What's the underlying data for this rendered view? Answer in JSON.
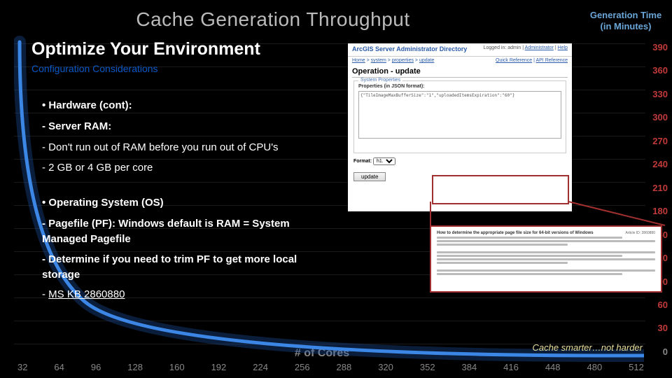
{
  "chart_data": {
    "type": "line",
    "title": "Cache Generation Throughput",
    "y_title": "Generation Time (in Minutes)",
    "xlabel": "# of Cores",
    "x": [
      32,
      64,
      96,
      128,
      160,
      192,
      224,
      256,
      288,
      320,
      352,
      384,
      416,
      448,
      480,
      512
    ],
    "y": [
      390,
      190,
      125,
      95,
      76,
      64,
      55,
      49,
      44,
      40,
      36,
      33,
      31,
      29,
      27,
      25
    ],
    "ylim": [
      0,
      390
    ],
    "y_ticks": [
      390,
      360,
      330,
      300,
      270,
      240,
      210,
      180,
      150,
      120,
      90,
      60,
      30,
      0
    ]
  },
  "slide": {
    "heading": "Optimize Your Environment",
    "subheading": "Configuration Considerations",
    "section1": {
      "title": "Hardware (cont):",
      "sub1": "Server RAM:",
      "b1": "Don't run out of RAM before you run out of CPU's",
      "b2": "2 GB or 4 GB per core"
    },
    "section2": {
      "title": "Operating System (OS)",
      "sub1": "Pagefile (PF): Windows default is RAM = System Managed Pagefile",
      "sub2": "Determine if you need to trim PF to get more local storage",
      "link": "MS KB 2860880"
    },
    "tagline": "Cache smarter…not harder"
  },
  "admin": {
    "product": "ArcGIS Server Administrator Directory",
    "logged": "Logged in: admin | ",
    "admin_link": "Administrator",
    "help_link": "Help",
    "crumb_left": [
      "Home",
      "system",
      "properties",
      "update"
    ],
    "crumb_right": [
      "Quick Reference",
      "API Reference"
    ],
    "operation": "Operation - update",
    "section_title": "System Properties",
    "field_label": "Properties (in JSON format):",
    "textarea_value": "{\"TileImageMaxBufferSize\":\"1\",\"uploadedItemsExpiration\":\"60\"}",
    "format_label": "Format:",
    "format_value": "h1.",
    "button": "update"
  },
  "zoom": {
    "heading": "How to determine the appropriate page file size for 64-bit versions of Windows",
    "article_id": "Article ID: 2860880"
  }
}
